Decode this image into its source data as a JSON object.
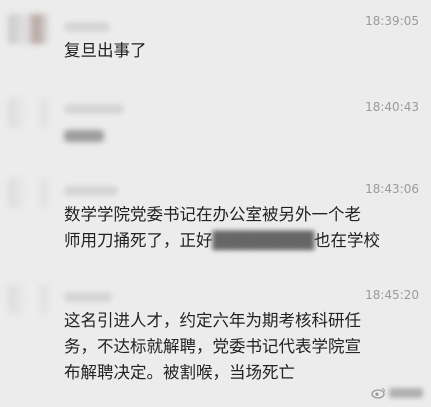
{
  "messages": [
    {
      "time": "18:39:05",
      "lines": [
        "复旦出事了"
      ]
    },
    {
      "time": "18:40:43",
      "lines": []
    },
    {
      "time": "18:43:06",
      "lines": [
        "数学学院党委书记在办公室被另外一个老",
        "师用刀捅死了，正好",
        "也在学校"
      ]
    },
    {
      "time": "18:45:20",
      "lines": [
        "这名引进人才，约定六年为期考核科研任",
        "务，不达标就解聘，党委书记代表学院宣",
        "布解聘决定。被割喉，当场死亡"
      ]
    }
  ]
}
